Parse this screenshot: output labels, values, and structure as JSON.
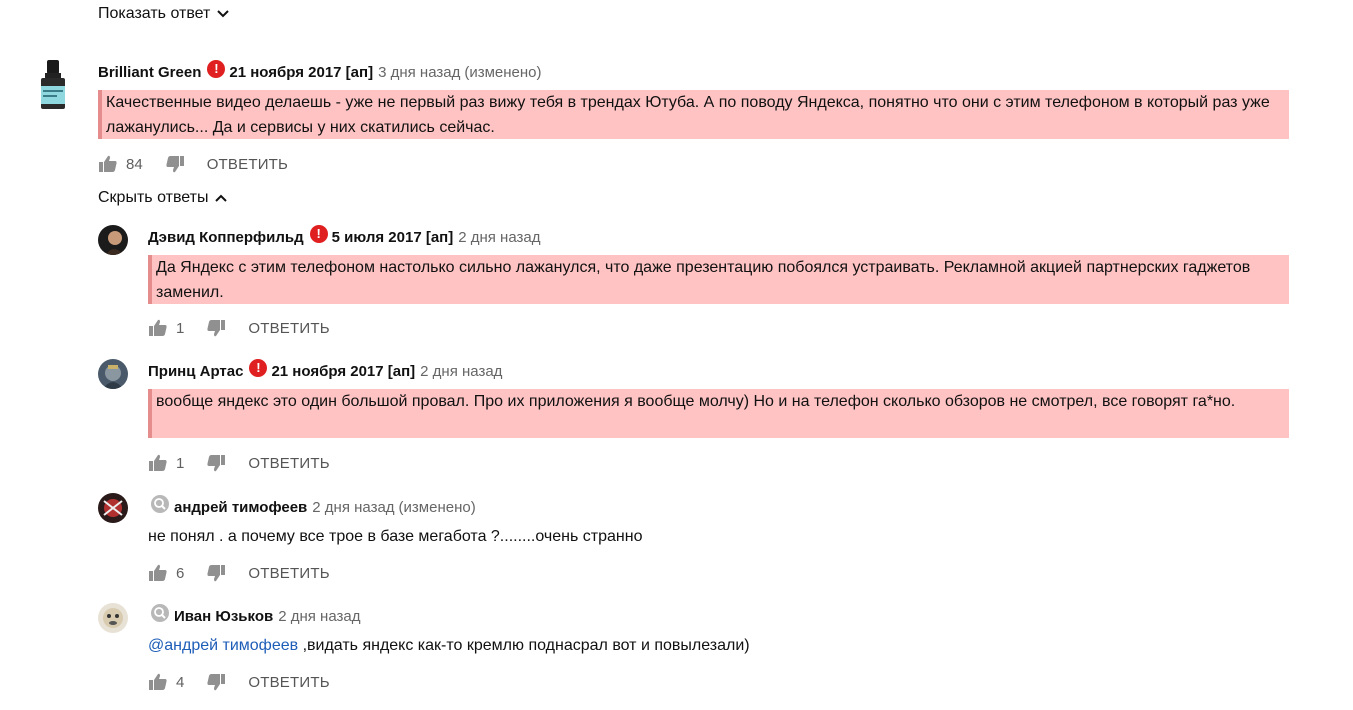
{
  "show_answer": "Показать ответ",
  "hide_answers": "Скрыть ответы",
  "reply_label": "ОТВЕТИТЬ",
  "comments": [
    {
      "author": "Brilliant Green",
      "date_bold": "21 ноября 2017 [ап]",
      "ago": "3 дня назад",
      "edited": "(изменено)",
      "text": "Качественные видео делаешь - уже не первый раз вижу тебя в трендах Ютуба. А по поводу Яндекса, понятно что они с этим телефоном в который раз уже лажанулись... Да и сервисы у них скатились сейчас.",
      "likes": "84"
    },
    {
      "author": "Дэвид Копперфильд",
      "date_bold": "5 июля 2017 [ап]",
      "ago": "2 дня назад",
      "text": "Да Яндекс с этим телефоном настолько сильно лажанулся, что даже презентацию побоялся устраивать. Рекламной акцией партнерских гаджетов заменил.",
      "likes": "1"
    },
    {
      "author": "Принц Артас",
      "date_bold": "21 ноября 2017 [ап]",
      "ago": "2 дня назад",
      "text": "вообще яндекс это один большой провал. Про их приложения я вообще молчу) Но и на телефон сколько обзоров не смотрел, все говорят га*но.",
      "likes": "1"
    },
    {
      "author": "андрей тимофеев",
      "ago": "2 дня назад",
      "edited": "(изменено)",
      "text": "не понял . а почему все трое  в базе мегабота ?........очень странно",
      "likes": "6"
    },
    {
      "author": "Иван Юзьков",
      "ago": "2 дня назад",
      "mention": "@андрей тимофеев",
      "text": " ,видать яндекс как-то кремлю поднасрал вот и повылезали)",
      "likes": "4"
    }
  ],
  "colors": {
    "highlight": "#ffc3c3",
    "highlight_border": "#e58c8c",
    "warning_red": "#e02020",
    "mention_blue": "#1e5db8"
  },
  "icons": [
    "chevron-down-icon",
    "chevron-up-icon",
    "exclamation-icon",
    "magnifier-icon",
    "thumbs-up-icon",
    "thumbs-down-icon"
  ]
}
